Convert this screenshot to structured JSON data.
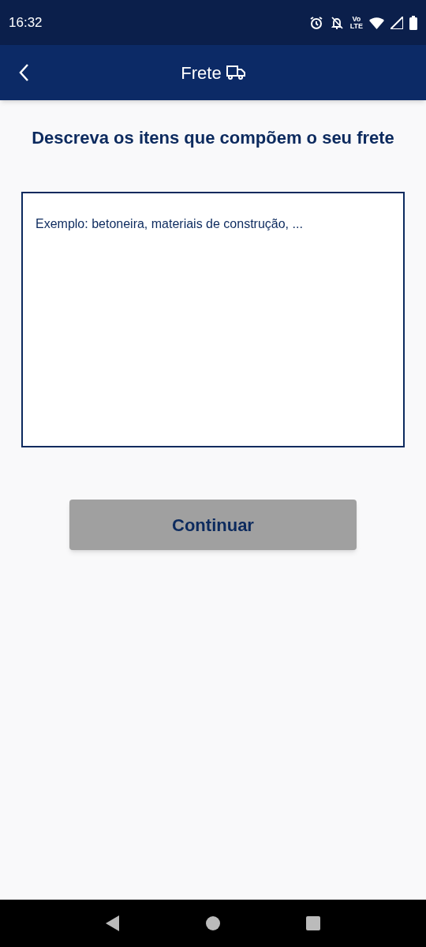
{
  "status_bar": {
    "time": "16:32",
    "volte_top": "Vo",
    "volte_bottom": "LTE"
  },
  "app_bar": {
    "title": "Frete"
  },
  "heading": "Descreva os itens que compõem o seu frete",
  "description_field": {
    "placeholder": "Exemplo: betoneira, materiais de construção, ..."
  },
  "continue_button": {
    "label": "Continuar",
    "disabled": true
  }
}
